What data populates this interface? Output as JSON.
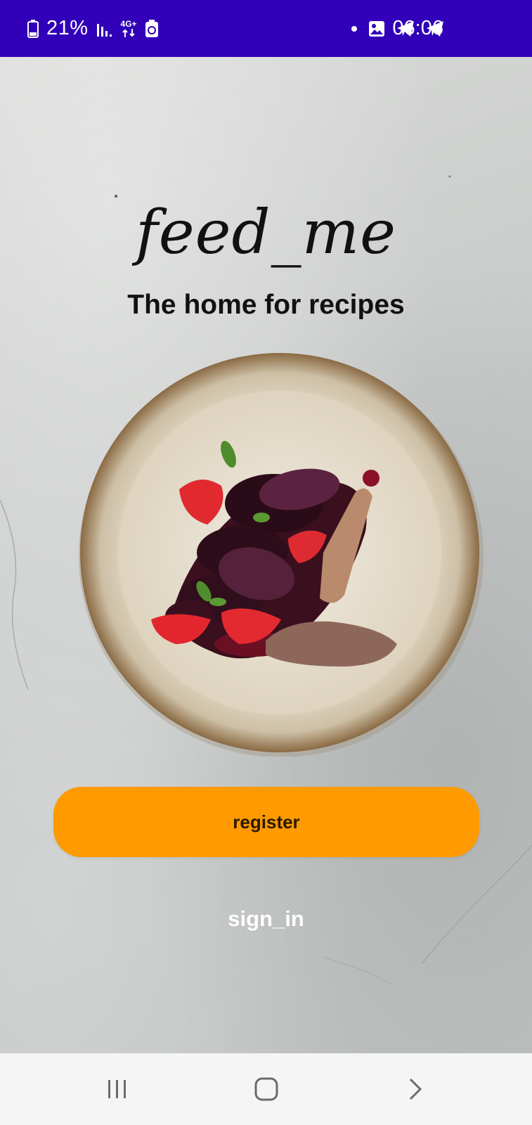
{
  "status_bar": {
    "battery": "21%",
    "network": "4G+",
    "time": "06:06",
    "icons": [
      "battery-icon",
      "signal-icon",
      "data-icon",
      "recycle-icon",
      "dot-icon",
      "image-icon",
      "telegram-icon",
      "telegram-icon"
    ]
  },
  "app": {
    "title": "feed_me",
    "subtitle": "The home for recipes"
  },
  "actions": {
    "register_label": "register",
    "sign_in_label": "sign_in"
  },
  "navigation": {
    "icons": [
      "recents-icon",
      "home-icon",
      "back-icon"
    ]
  },
  "colors": {
    "status_bar": "#3100b8",
    "accent": "#ff9a00",
    "nav_bar": "#f5f5f5"
  }
}
